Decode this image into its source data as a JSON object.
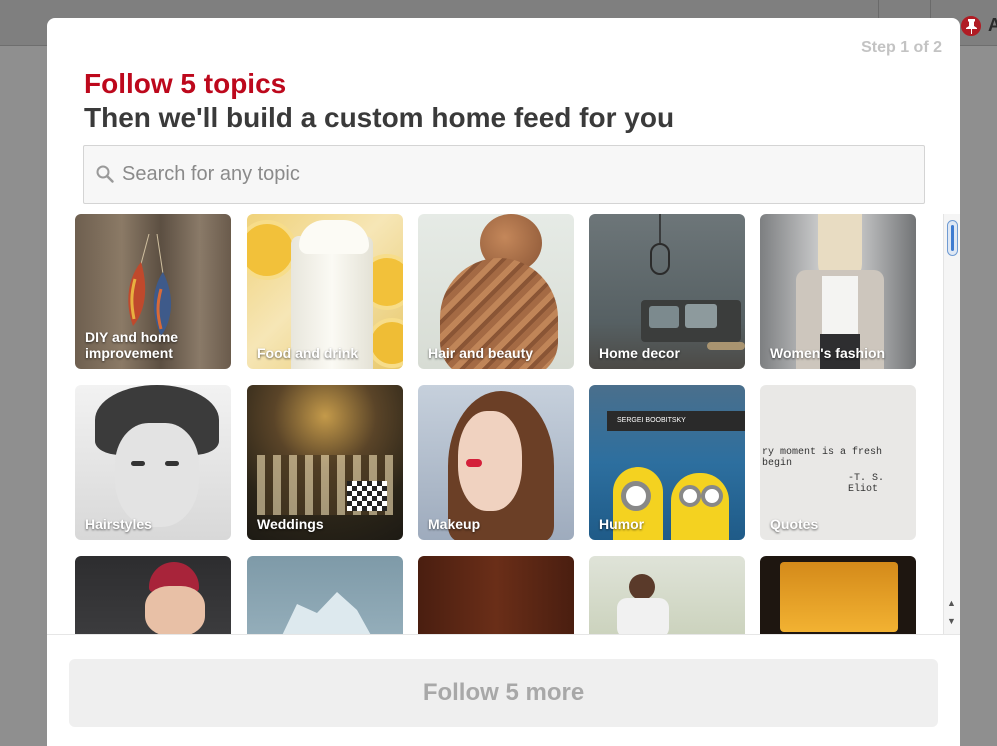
{
  "modal": {
    "step": "Step 1 of 2",
    "title": "Follow 5 topics",
    "subtitle": "Then we'll build a custom home feed for you",
    "search": {
      "placeholder": "Search for any topic"
    },
    "topics": [
      {
        "label": "DIY and home improvement",
        "color": "#7a6a58"
      },
      {
        "label": "Food and drink",
        "color": "#e7d7a6"
      },
      {
        "label": "Hair and beauty",
        "color": "#b48a6a"
      },
      {
        "label": "Home decor",
        "color": "#5f6669"
      },
      {
        "label": "Women's fashion",
        "color": "#c8c5c2"
      },
      {
        "label": "Hairstyles",
        "color": "#d5d5d5"
      },
      {
        "label": "Weddings",
        "color": "#3a2e20"
      },
      {
        "label": "Makeup",
        "color": "#a4b1c5"
      },
      {
        "label": "Humor",
        "color": "#2d6f9f"
      },
      {
        "label": "Quotes",
        "color": "#e9e8e6"
      },
      {
        "label": "",
        "color": "#3a3a3c"
      },
      {
        "label": "",
        "color": "#8fa9b7"
      },
      {
        "label": "",
        "color": "#4a1e10"
      },
      {
        "label": "",
        "color": "#b9c3a4"
      },
      {
        "label": "",
        "color": "#2a1c12"
      }
    ],
    "quote_image_text": {
      "line1": "ry moment is a fresh begin",
      "line2": "-T. S. Eliot"
    },
    "humor_sign_text": "SERGEI BOOBITSKY",
    "follow_button": "Follow 5 more"
  },
  "colors": {
    "accent": "#bd081c",
    "subtitle": "#3a3a3a",
    "button_bg": "#efefef",
    "button_text": "#a8a8a8"
  }
}
